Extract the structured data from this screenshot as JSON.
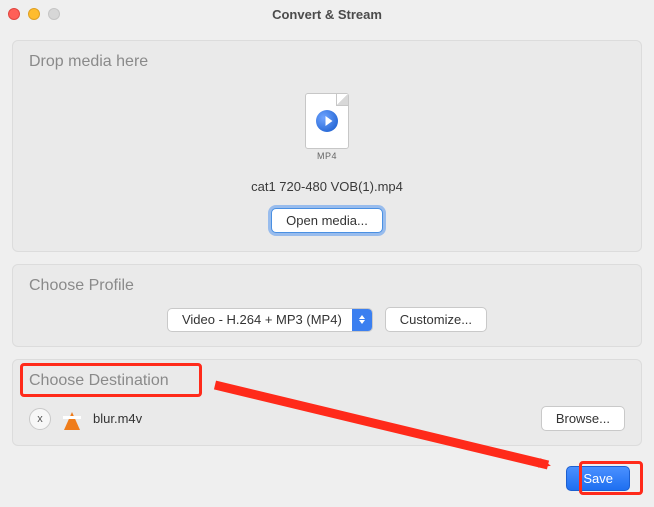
{
  "window": {
    "title": "Convert & Stream"
  },
  "drop_panel": {
    "title": "Drop media here",
    "file_ext": "MP4",
    "filename": "cat1 720-480 VOB(1).mp4",
    "open_button": "Open media..."
  },
  "profile_panel": {
    "title": "Choose Profile",
    "selected": "Video - H.264 + MP3 (MP4)",
    "customize_button": "Customize..."
  },
  "dest_panel": {
    "title": "Choose Destination",
    "file": "blur.m4v",
    "browse_button": "Browse...",
    "remove_label": "x"
  },
  "footer": {
    "save_button": "Save"
  },
  "annotation": {
    "accent": "#ff2a1a"
  }
}
